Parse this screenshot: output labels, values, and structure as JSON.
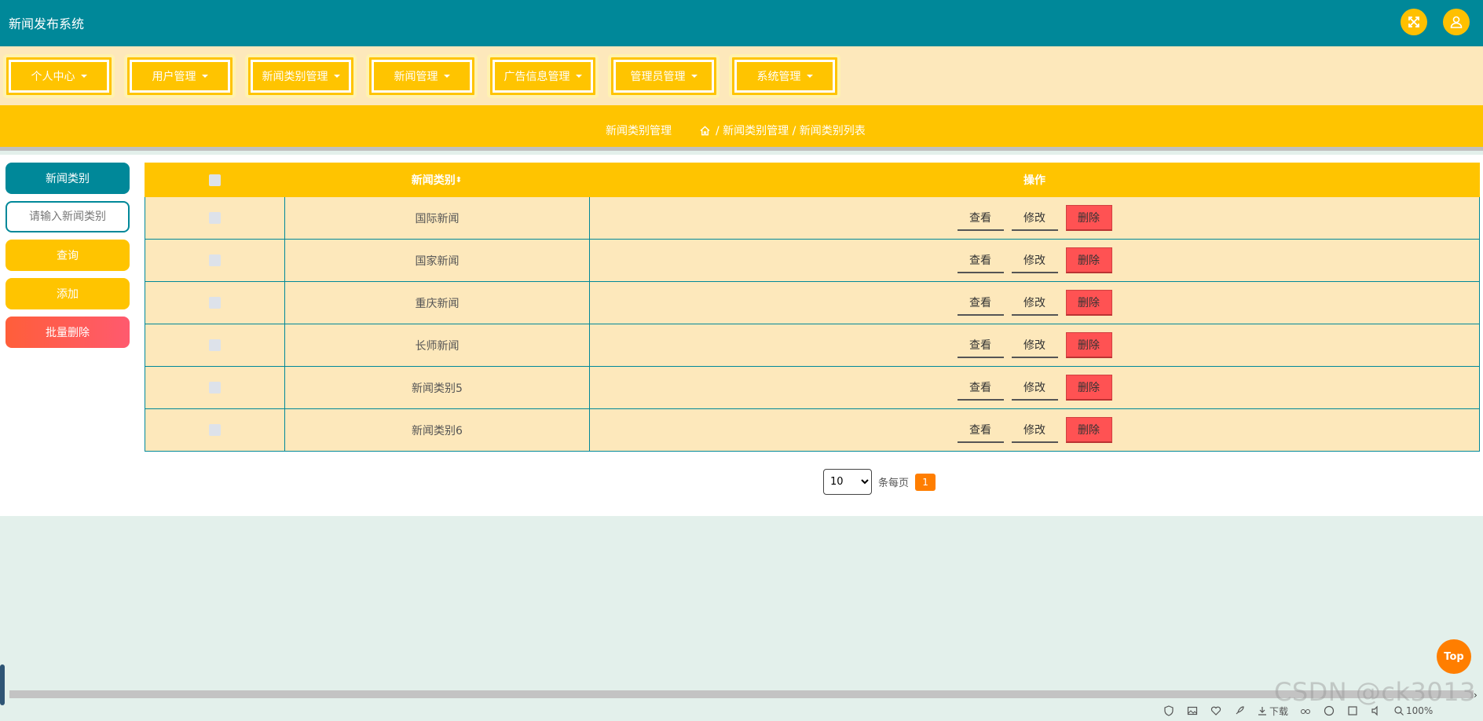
{
  "header": {
    "title": "新闻发布系统",
    "icons": [
      "fullscreen-icon",
      "user-icon"
    ]
  },
  "nav": {
    "items": [
      {
        "label": "个人中心"
      },
      {
        "label": "用户管理"
      },
      {
        "label": "新闻类别管理"
      },
      {
        "label": "新闻管理"
      },
      {
        "label": "广告信息管理"
      },
      {
        "label": "管理员管理"
      },
      {
        "label": "系统管理"
      }
    ]
  },
  "breadcrumb": {
    "title": "新闻类别管理",
    "path": "/ 新闻类别管理 / 新闻类别列表"
  },
  "sidebar": {
    "label": "新闻类别",
    "input_placeholder": "请输入新闻类别",
    "query_button": "查询",
    "add_button": "添加",
    "batch_delete_button": "批量删除"
  },
  "table": {
    "headers": {
      "category": "新闻类别",
      "action": "操作"
    },
    "rows": [
      {
        "category": "国际新闻"
      },
      {
        "category": "国家新闻"
      },
      {
        "category": "重庆新闻"
      },
      {
        "category": "长师新闻"
      },
      {
        "category": "新闻类别5"
      },
      {
        "category": "新闻类别6"
      }
    ],
    "actions": {
      "view": "查看",
      "edit": "修改",
      "delete": "删除"
    }
  },
  "pagination": {
    "page_size": "10",
    "per_page_label": "条每页",
    "current_page": "1"
  },
  "top_button": "Top",
  "status_bar": {
    "download_label": "下载",
    "zoom": "100%"
  },
  "watermark": "CSDN @ck3013",
  "colors": {
    "primary": "#008899",
    "accent": "#ffc400",
    "light": "#fde8bb",
    "danger": "#ff5253",
    "orange": "#ff7e00"
  }
}
